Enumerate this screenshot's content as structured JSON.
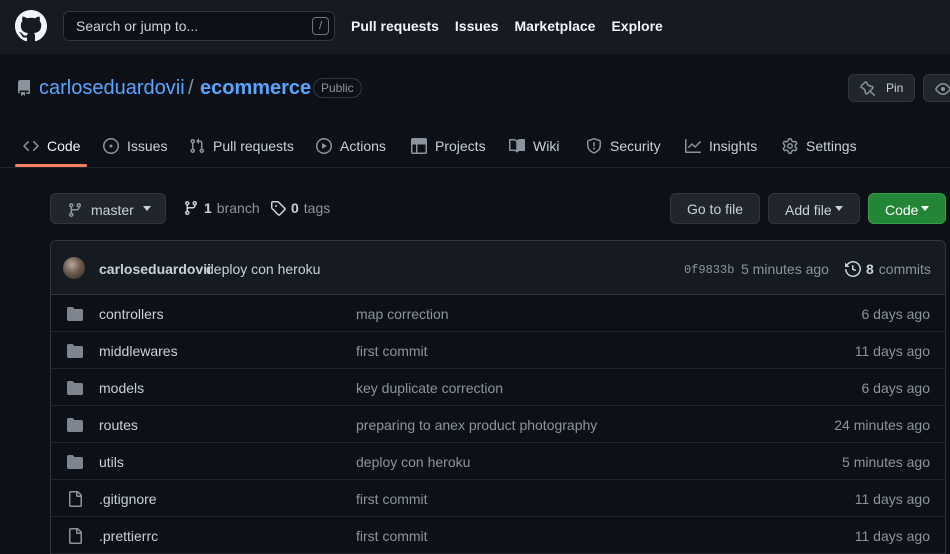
{
  "header": {
    "search_placeholder": "Search or jump to...",
    "search_shortcut": "/",
    "nav": [
      "Pull requests",
      "Issues",
      "Marketplace",
      "Explore"
    ]
  },
  "repo": {
    "owner": "carloseduardovii",
    "separator": "/",
    "name": "ecommerce",
    "visibility": "Public",
    "pin_label": "Pin"
  },
  "tabs": [
    {
      "label": "Code",
      "icon": "code-icon"
    },
    {
      "label": "Issues",
      "icon": "issue-icon"
    },
    {
      "label": "Pull requests",
      "icon": "pull-request-icon"
    },
    {
      "label": "Actions",
      "icon": "play-icon"
    },
    {
      "label": "Projects",
      "icon": "table-icon"
    },
    {
      "label": "Wiki",
      "icon": "book-icon"
    },
    {
      "label": "Security",
      "icon": "shield-icon"
    },
    {
      "label": "Insights",
      "icon": "graph-icon"
    },
    {
      "label": "Settings",
      "icon": "gear-icon"
    }
  ],
  "file_nav": {
    "branch": "master",
    "branch_count": "1",
    "branch_word": "branch",
    "tag_count": "0",
    "tag_word": "tags",
    "goto_label": "Go to file",
    "add_file_label": "Add file",
    "code_label": "Code"
  },
  "latest_commit": {
    "author": "carloseduardovii",
    "message": "deploy con heroku",
    "sha": "0f9833b",
    "time": "5 minutes ago",
    "count": "8",
    "count_word": "commits"
  },
  "files": [
    {
      "name": "controllers",
      "type": "directory",
      "commit": "map correction",
      "age": "6 days ago"
    },
    {
      "name": "middlewares",
      "type": "directory",
      "commit": "first commit",
      "age": "11 days ago"
    },
    {
      "name": "models",
      "type": "directory",
      "commit": "key duplicate correction",
      "age": "6 days ago"
    },
    {
      "name": "routes",
      "type": "directory",
      "commit": "preparing to anex product photography",
      "age": "24 minutes ago"
    },
    {
      "name": "utils",
      "type": "directory",
      "commit": "deploy con heroku",
      "age": "5 minutes ago"
    },
    {
      "name": ".gitignore",
      "type": "file",
      "commit": "first commit",
      "age": "11 days ago"
    },
    {
      "name": ".prettierrc",
      "type": "file",
      "commit": "first commit",
      "age": "11 days ago"
    }
  ],
  "colors": {
    "background": "#0d1117",
    "header": "#161b22",
    "link": "#58a6ff",
    "tab_underline": "#f78166",
    "code_button": "#238636",
    "folder": "#7d8590"
  }
}
